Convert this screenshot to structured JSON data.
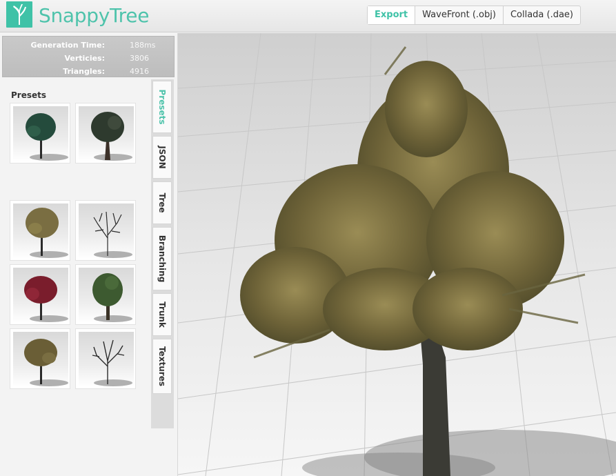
{
  "app": {
    "title": "SnappyTree"
  },
  "export": {
    "label": "Export",
    "obj_label": "WaveFront (.obj)",
    "dae_label": "Collada (.dae)"
  },
  "stats": {
    "generation_time_label": "Generation Time:",
    "generation_time_value": "188ms",
    "verticies_label": "Verticies:",
    "verticies_value": "3806",
    "triangles_label": "Triangles:",
    "triangles_value": "4916"
  },
  "presets": {
    "title": "Presets",
    "count": 8
  },
  "tabs": {
    "presets": "Presets",
    "json": "JSON",
    "tree": "Tree",
    "branching": "Branching",
    "trunk": "Trunk",
    "textures": "Textures"
  },
  "colors": {
    "accent": "#3fc2a7",
    "foliage": "#8a7e4a",
    "trunk": "#3b3b35"
  }
}
